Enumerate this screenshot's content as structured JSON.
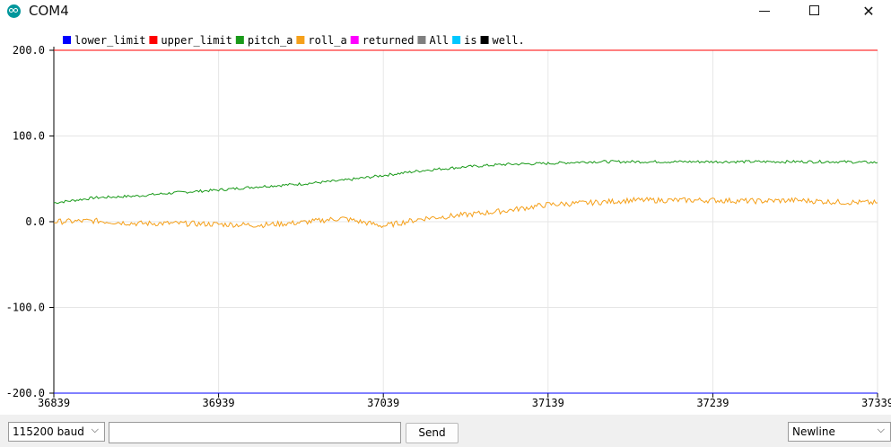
{
  "window": {
    "title": "COM4",
    "app_icon": "arduino-icon"
  },
  "controls": {
    "baud": "115200 baud",
    "input_value": "",
    "send_label": "Send",
    "line_ending": "Newline"
  },
  "chart_data": {
    "type": "line",
    "title": "",
    "xlabel": "",
    "ylabel": "",
    "xlim": [
      36839,
      37339
    ],
    "ylim": [
      -200,
      200
    ],
    "x_ticks": [
      "36839",
      "36939",
      "37039",
      "37139",
      "37239",
      "37339"
    ],
    "y_ticks": [
      "200.0",
      "100.0",
      "0.0",
      "-100.0",
      "-200.0"
    ],
    "grid": true,
    "legend_position": "top-left",
    "series": [
      {
        "name": "lower_limit",
        "color": "#0000ff",
        "x": [
          36839,
          37339
        ],
        "values": [
          -200,
          -200
        ]
      },
      {
        "name": "upper_limit",
        "color": "#ff0000",
        "x": [
          36839,
          37339
        ],
        "values": [
          200,
          200
        ]
      },
      {
        "name": "pitch_a",
        "color": "#1a9a1a",
        "x": [
          36839,
          36864,
          36889,
          36914,
          36939,
          36964,
          36989,
          37014,
          37039,
          37064,
          37089,
          37114,
          37139,
          37164,
          37189,
          37214,
          37239,
          37264,
          37289,
          37314,
          37339
        ],
        "values": [
          22,
          28,
          30,
          34,
          37,
          41,
          44,
          48,
          54,
          60,
          64,
          67,
          68,
          70,
          70,
          70,
          70,
          70,
          70,
          70,
          69
        ]
      },
      {
        "name": "roll_a",
        "color": "#f5a01a",
        "x": [
          36839,
          36864,
          36889,
          36914,
          36939,
          36964,
          36989,
          37014,
          37039,
          37064,
          37089,
          37114,
          37139,
          37164,
          37189,
          37214,
          37239,
          37264,
          37289,
          37314,
          37339
        ],
        "values": [
          0,
          1,
          -2,
          -2,
          -3,
          -4,
          -1,
          4,
          -5,
          4,
          8,
          13,
          20,
          22,
          25,
          25,
          25,
          24,
          25,
          23,
          22
        ]
      },
      {
        "name": "returned",
        "color": "#ff00ff",
        "x": [],
        "values": []
      },
      {
        "name": "All",
        "color": "#7f7f7f",
        "x": [],
        "values": []
      },
      {
        "name": "is",
        "color": "#00c8ff",
        "x": [],
        "values": []
      },
      {
        "name": "well.",
        "color": "#000000",
        "x": [],
        "values": []
      }
    ]
  }
}
